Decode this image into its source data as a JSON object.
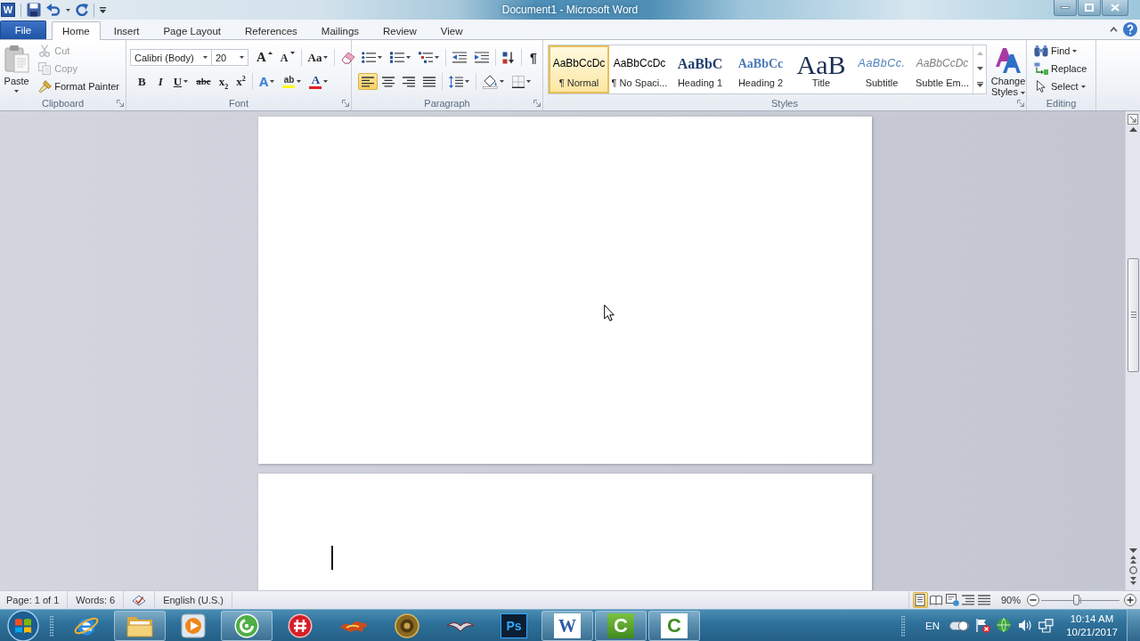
{
  "window": {
    "title": "Document1 - Microsoft Word",
    "app_glyph": "W"
  },
  "tabs": [
    {
      "label": "File",
      "kind": "file",
      "selected": false
    },
    {
      "label": "Home",
      "kind": "tab",
      "selected": true
    },
    {
      "label": "Insert",
      "kind": "tab",
      "selected": false
    },
    {
      "label": "Page Layout",
      "kind": "tab",
      "selected": false
    },
    {
      "label": "References",
      "kind": "tab",
      "selected": false
    },
    {
      "label": "Mailings",
      "kind": "tab",
      "selected": false
    },
    {
      "label": "Review",
      "kind": "tab",
      "selected": false
    },
    {
      "label": "View",
      "kind": "tab",
      "selected": false
    }
  ],
  "clipboard": {
    "label": "Clipboard",
    "launcher": true,
    "paste": {
      "label": "Paste",
      "dropdown": true
    },
    "commands": [
      {
        "label": "Cut",
        "kind": "cut",
        "disabled": true
      },
      {
        "label": "Copy",
        "kind": "copy",
        "disabled": true
      },
      {
        "label": "Format Painter",
        "kind": "painter",
        "disabled": false
      }
    ]
  },
  "font": {
    "label": "Font",
    "launcher": true,
    "name": {
      "value": "Calibri (Body)"
    },
    "size": {
      "value": "20"
    },
    "row_1": [
      [
        {
          "kind": "grow",
          "glyph": "A",
          "dropdown": false
        },
        {
          "kind": "shrink",
          "glyph": "A",
          "dropdown": false
        }
      ],
      [
        {
          "kind": "case",
          "glyph": "Aa",
          "dropdown": true
        }
      ],
      [
        {
          "kind": "clear",
          "dropdown": false
        }
      ]
    ],
    "row_2": [
      [
        {
          "kind": "bold",
          "glyph": "B",
          "dropdown": false
        },
        {
          "kind": "italic",
          "glyph": "I",
          "dropdown": false
        },
        {
          "kind": "underline",
          "glyph": "U",
          "dropdown": true
        },
        {
          "kind": "strike",
          "glyph": "abc",
          "dropdown": false
        },
        {
          "kind": "subscript",
          "glyph": "x$_{2}$",
          "dropdown": false
        },
        {
          "kind": "superscript",
          "glyph": "x$^{2}$",
          "dropdown": false
        }
      ],
      [
        {
          "kind": "effects",
          "glyph": "A",
          "dropdown": true
        },
        {
          "kind": "highlight",
          "glyph": "ab",
          "dropdown": true,
          "color": "#ffff00"
        },
        {
          "kind": "color",
          "glyph": "A",
          "dropdown": true,
          "color": "#e51c23"
        }
      ]
    ]
  },
  "paragraph": {
    "label": "Paragraph",
    "launcher": true,
    "row_1": [
      [
        {
          "kind": "bullets",
          "dropdown": true
        },
        {
          "kind": "numbering",
          "dropdown": true
        },
        {
          "kind": "multilevel",
          "dropdown": true
        }
      ],
      [
        {
          "kind": "outdent",
          "dropdown": false
        },
        {
          "kind": "indent",
          "dropdown": false
        }
      ],
      [
        {
          "kind": "sort",
          "dropdown": false
        }
      ],
      [
        {
          "kind": "marks",
          "glyph": "¶",
          "dropdown": false
        }
      ]
    ],
    "row_2": [
      [
        {
          "kind": "left",
          "dropdown": false,
          "selected": true
        },
        {
          "kind": "center",
          "dropdown": false,
          "selected": false
        },
        {
          "kind": "right",
          "dropdown": false,
          "selected": false
        },
        {
          "kind": "justify",
          "dropdown": false,
          "selected": false
        }
      ],
      [
        {
          "kind": "spacing",
          "dropdown": true
        }
      ],
      [
        {
          "kind": "shading",
          "dropdown": true
        },
        {
          "kind": "borders",
          "dropdown": true
        }
      ]
    ]
  },
  "styles": {
    "label": "Styles",
    "launcher": true,
    "gallery": [
      {
        "kind": "normal",
        "preview": "AaBbCcDc",
        "name": "¶ Normal",
        "selected": true
      },
      {
        "kind": "normal",
        "preview": "AaBbCcDc",
        "name": "¶ No Spaci...",
        "selected": false
      },
      {
        "kind": "heading1",
        "preview": "AaBbC",
        "name": "Heading 1",
        "selected": false
      },
      {
        "kind": "heading2",
        "preview": "AaBbCc",
        "name": "Heading 2",
        "selected": false
      },
      {
        "kind": "title",
        "preview": "AaB",
        "name": "Title",
        "selected": false
      },
      {
        "kind": "subtitle",
        "preview": "AaBbCc.",
        "name": "Subtitle",
        "selected": false
      },
      {
        "kind": "emphasis",
        "preview": "AaBbCcDc",
        "name": "Subtle Em...",
        "selected": false
      }
    ],
    "change_styles": {
      "label": "Change Styles",
      "dropdown": true
    }
  },
  "editing": {
    "label": "Editing",
    "launcher": false,
    "commands": [
      {
        "label": "Find",
        "kind": "find",
        "dropdown": true
      },
      {
        "label": "Replace",
        "kind": "replace",
        "dropdown": false
      },
      {
        "label": "Select",
        "kind": "select",
        "dropdown": true
      }
    ]
  },
  "status": {
    "page": "Page: 1 of 1",
    "words": "Words: 6",
    "language": "English (U.S.)",
    "views": [
      {
        "kind": "print",
        "selected": true
      },
      {
        "kind": "reading",
        "selected": false
      },
      {
        "kind": "web",
        "selected": false
      },
      {
        "kind": "outline",
        "selected": false
      },
      {
        "kind": "draft",
        "selected": false
      }
    ],
    "zoom": "90%",
    "zoom_slider": {
      "level": 0.45
    }
  },
  "taskbar": {
    "apps": [
      {
        "kind": "browser",
        "running": false
      },
      {
        "kind": "folder",
        "running": true
      },
      {
        "kind": "player",
        "running": false
      },
      {
        "kind": "swirl",
        "running": true
      },
      {
        "kind": "hash",
        "running": false
      },
      {
        "kind": "flame",
        "running": false
      },
      {
        "kind": "medallion",
        "running": false
      },
      {
        "kind": "wings",
        "running": false
      },
      {
        "kind": "dark-tile",
        "glyph": "Ps",
        "running": false
      },
      {
        "kind": "blue-tile",
        "glyph": "W",
        "running": true
      },
      {
        "kind": "green-tile",
        "glyph": "C",
        "running": true
      },
      {
        "kind": "light-tile",
        "glyph": "C",
        "running": true
      }
    ],
    "tray": {
      "language": "EN",
      "time": "10:14 AM",
      "date": "10/21/2017"
    }
  }
}
